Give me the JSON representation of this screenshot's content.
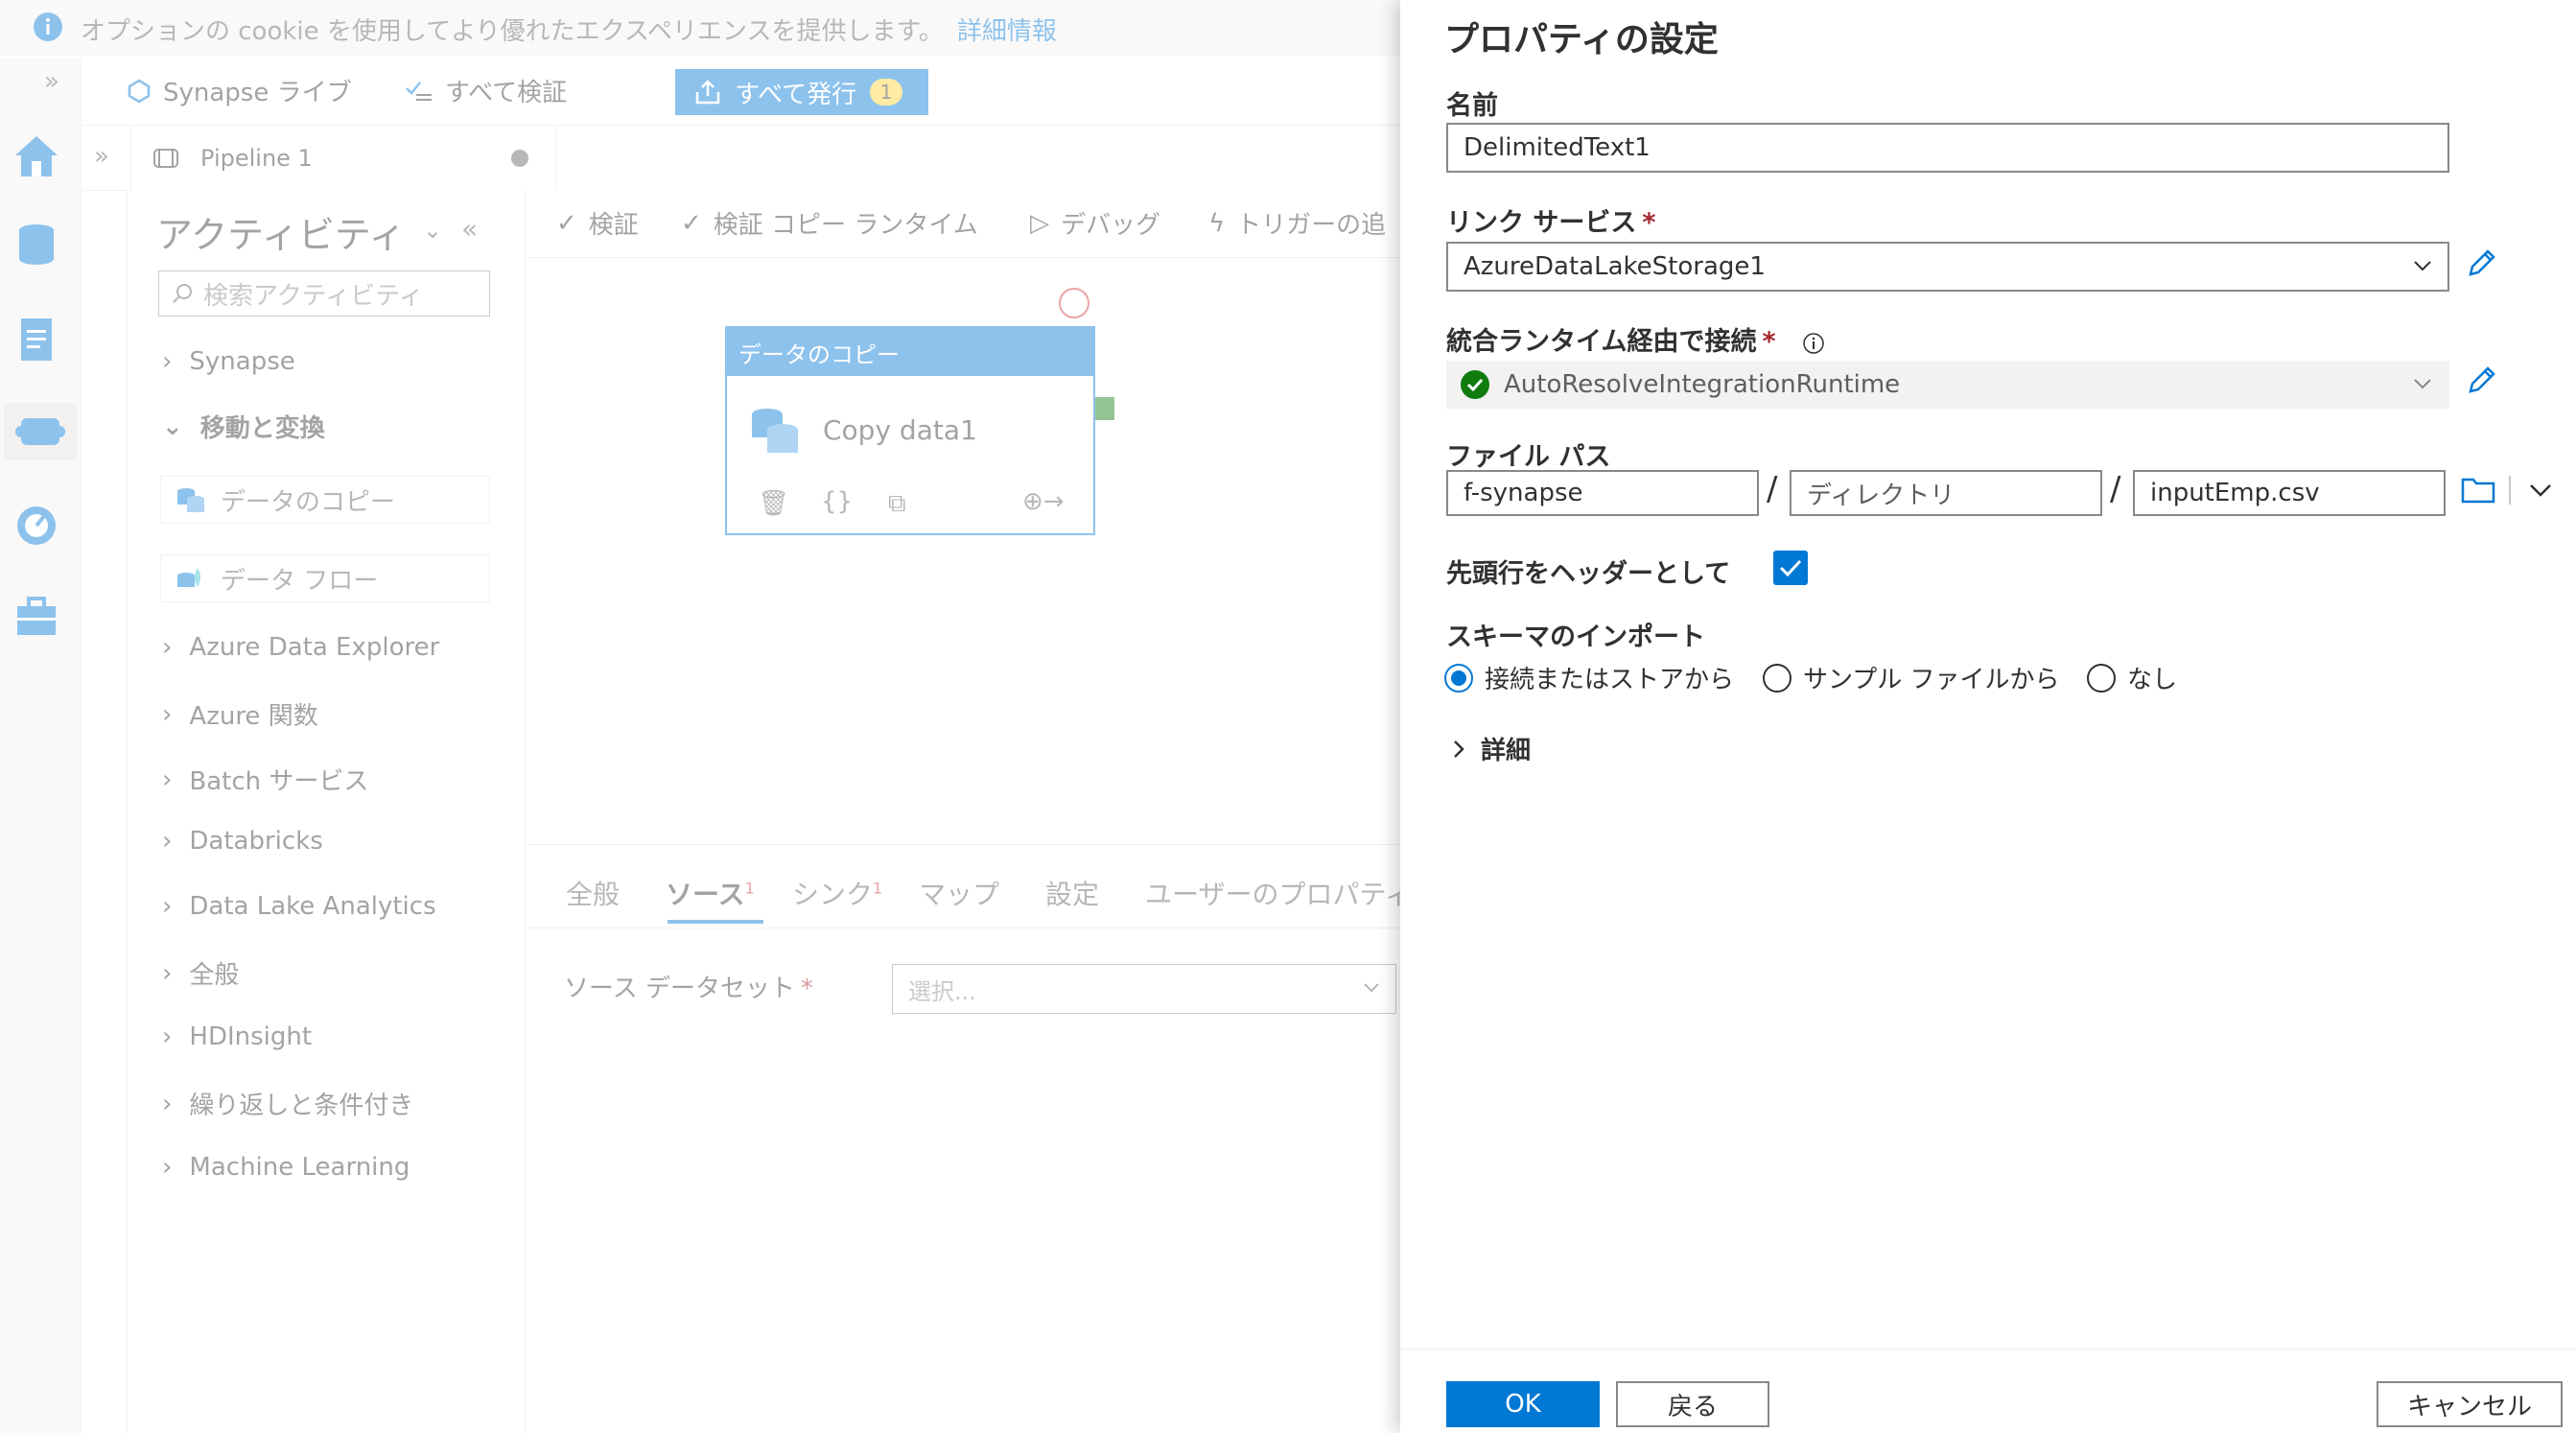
{
  "cookie_bar": {
    "message": "オプションの cookie を使用してより優れたエクスペリエンスを提供します。",
    "link": "詳細情報"
  },
  "toolbar": {
    "synapse_live": "Synapse ライブ",
    "validate_all": "すべて検証",
    "publish_all": "すべて発行",
    "publish_count": "1"
  },
  "tab": {
    "pipeline": "Pipeline 1"
  },
  "activities": {
    "title": "アクティビティ",
    "search_placeholder": "検索アクティビティ",
    "categories": [
      "Synapse",
      "移動と変換",
      "Azure Data Explorer",
      "Azure 関数",
      "Batch サービス",
      "Databricks",
      "Data Lake Analytics",
      "全般",
      "HDInsight",
      "繰り返しと条件付き",
      "Machine Learning"
    ],
    "items": [
      "データのコピー",
      "データ フロー"
    ]
  },
  "canvas_toolbar": {
    "validate": "検証",
    "validate_copy_runtime": "検証 コピー ランタイム",
    "debug": "デバッグ",
    "add_trigger": "トリガーの追"
  },
  "node": {
    "type": "データのコピー",
    "name": "Copy data1"
  },
  "bottom_tabs": {
    "general": "全般",
    "source": "ソース",
    "source_badge": "1",
    "sink": "シンク",
    "sink_badge": "1",
    "mapping": "マップ",
    "settings": "設定",
    "user_props": "ユーザーのプロパティ"
  },
  "source_dataset": {
    "label": "ソース データセット",
    "placeholder": "選択..."
  },
  "panel": {
    "title": "プロパティの設定",
    "name_label": "名前",
    "name_value": "DelimitedText1",
    "linked_service_label": "リンク サービス",
    "linked_service_value": "AzureDataLakeStorage1",
    "runtime_label": "統合ランタイム経由で接続",
    "runtime_value": "AutoResolveIntegrationRuntime",
    "file_path_label": "ファイル パス",
    "file_path_container": "f-synapse",
    "file_path_directory_placeholder": "ディレクトリ",
    "file_path_file": "inputEmp.csv",
    "header_label": "先頭行をヘッダーとして",
    "header_checked": true,
    "schema_label": "スキーマのインポート",
    "schema_options": [
      "接続またはストアから",
      "サンプル ファイルから",
      "なし"
    ],
    "schema_selected": "接続またはストアから",
    "advanced": "詳細",
    "required_mark": "*"
  },
  "buttons": {
    "ok": "OK",
    "back": "戻る",
    "cancel": "キャンセル"
  },
  "colors": {
    "accent": "#0078d4",
    "required": "#a4262c",
    "success": "#107c10",
    "error": "#d13438"
  }
}
